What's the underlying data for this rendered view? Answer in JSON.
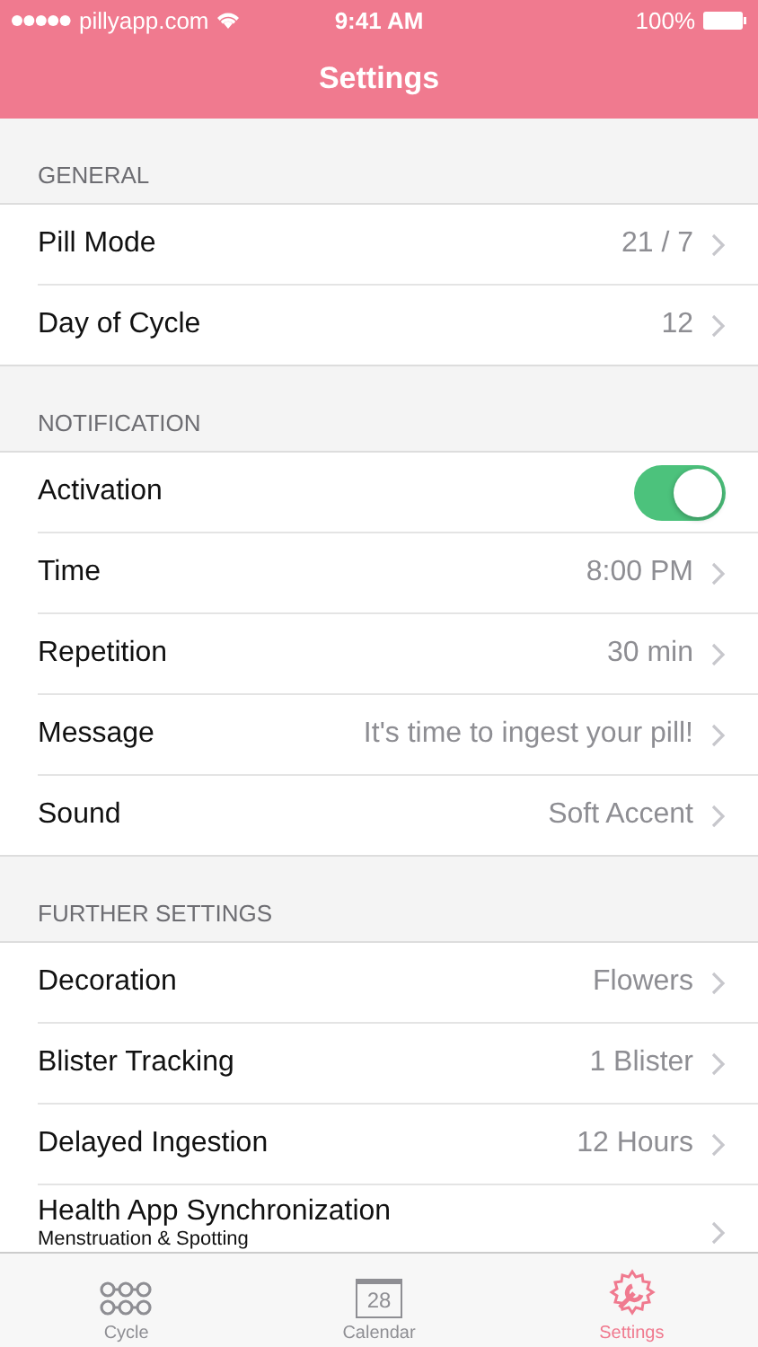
{
  "status_bar": {
    "carrier": "pillyapp.com",
    "time": "9:41 AM",
    "battery": "100%"
  },
  "nav": {
    "title": "Settings"
  },
  "sections": [
    {
      "header": "GENERAL",
      "rows": [
        {
          "kind": "value",
          "label": "Pill Mode",
          "value": "21 / 7"
        },
        {
          "kind": "value",
          "label": "Day of Cycle",
          "value": "12"
        }
      ]
    },
    {
      "header": "NOTIFICATION",
      "rows": [
        {
          "kind": "toggle",
          "label": "Activation",
          "on": true
        },
        {
          "kind": "value",
          "label": "Time",
          "value": "8:00 PM"
        },
        {
          "kind": "value",
          "label": "Repetition",
          "value": "30 min"
        },
        {
          "kind": "value",
          "label": "Message",
          "value": "It's time to ingest your pill!"
        },
        {
          "kind": "value",
          "label": "Sound",
          "value": "Soft Accent"
        }
      ]
    },
    {
      "header": "FURTHER SETTINGS",
      "rows": [
        {
          "kind": "value",
          "label": "Decoration",
          "value": "Flowers"
        },
        {
          "kind": "value",
          "label": "Blister Tracking",
          "value": "1 Blister"
        },
        {
          "kind": "value",
          "label": "Delayed Ingestion",
          "value": "12 Hours"
        },
        {
          "kind": "subtitle",
          "label": "Health App Synchronization",
          "subtitle": "Menstruation & Spotting"
        }
      ]
    }
  ],
  "tabs": [
    {
      "label": "Cycle",
      "selected": false
    },
    {
      "label": "Calendar",
      "selected": false,
      "date": "28"
    },
    {
      "label": "Settings",
      "selected": true
    }
  ]
}
